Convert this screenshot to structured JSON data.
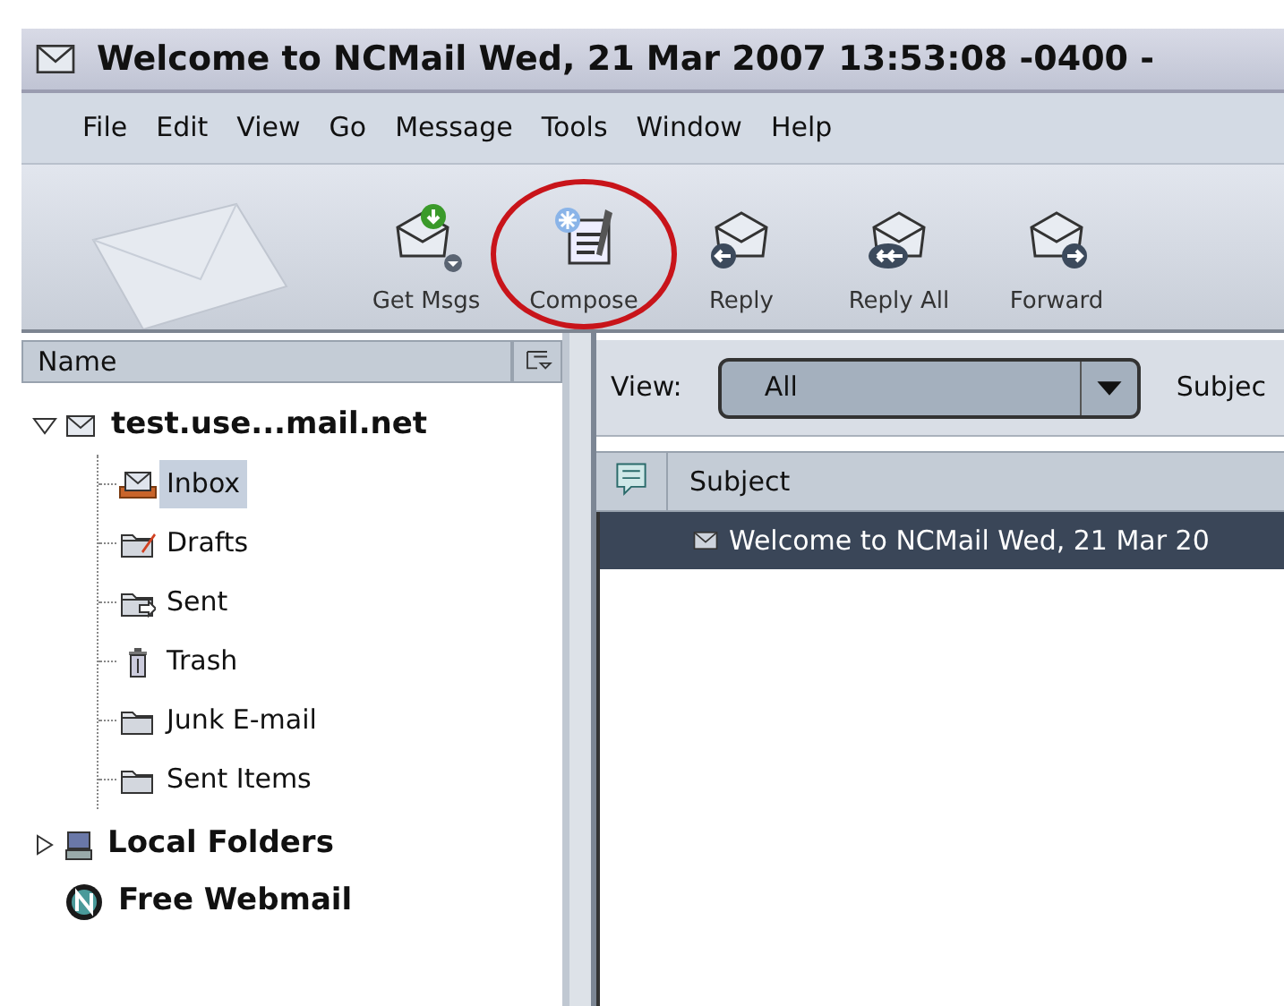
{
  "window": {
    "title": "Welcome to NCMail Wed, 21 Mar 2007 13:53:08 -0400 -"
  },
  "menu": [
    "File",
    "Edit",
    "View",
    "Go",
    "Message",
    "Tools",
    "Window",
    "Help"
  ],
  "toolbar": [
    {
      "label": "Get Msgs",
      "kind": "get"
    },
    {
      "label": "Compose",
      "kind": "compose",
      "circled": true
    },
    {
      "label": "Reply",
      "kind": "reply"
    },
    {
      "label": "Reply All",
      "kind": "replyall"
    },
    {
      "label": "Forward",
      "kind": "forward"
    }
  ],
  "folder_pane": {
    "column": "Name",
    "tree": [
      {
        "label": "test.use...mail.net",
        "kind": "account",
        "expanded": true,
        "children": [
          {
            "label": "Inbox",
            "kind": "inbox",
            "selected": true
          },
          {
            "label": "Drafts",
            "kind": "drafts",
            "selected": false
          },
          {
            "label": "Sent",
            "kind": "sent",
            "selected": false
          },
          {
            "label": "Trash",
            "kind": "trash",
            "selected": false
          },
          {
            "label": "Junk E-mail",
            "kind": "folder",
            "selected": false
          },
          {
            "label": "Sent Items",
            "kind": "folder",
            "selected": false
          }
        ]
      },
      {
        "label": "Local Folders",
        "kind": "local",
        "expanded": false
      },
      {
        "label": "Free Webmail",
        "kind": "webmail"
      }
    ]
  },
  "message_pane": {
    "view_label": "View:",
    "view_value": "All",
    "search_label": "Subjec",
    "column": "Subject",
    "rows": [
      {
        "subject": "Welcome to NCMail Wed, 21 Mar 20",
        "selected": true
      }
    ]
  }
}
